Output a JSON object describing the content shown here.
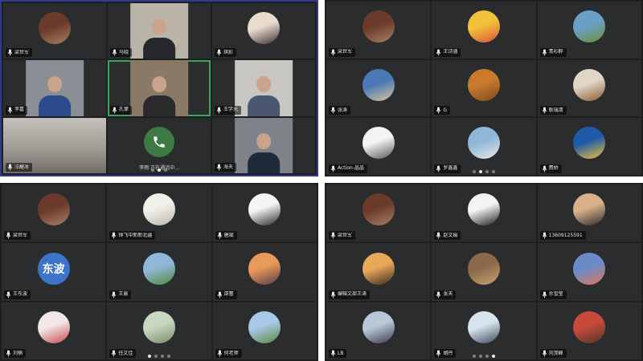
{
  "colors": {
    "panel_background": "#1e1f21",
    "tile_background": "#2b2c2e",
    "active_border": "#2f3a8f",
    "speaking_border": "#3aa55c",
    "phone_green": "#3d7a46",
    "dot_inactive": "#7d7e80",
    "dot_active": "#e6e6e6"
  },
  "panels": [
    {
      "tiles": [
        {
          "name": "梁世军",
          "kind": "avatar",
          "avatar": {
            "colors": [
              "#6b3a2a",
              "#a88064"
            ]
          }
        },
        {
          "name": "马晓",
          "kind": "video",
          "video": {
            "bg": "#b9b3a8",
            "shirt": "#26282e"
          }
        },
        {
          "name": "琪彩",
          "kind": "avatar",
          "avatar": {
            "colors": [
              "#e8dccf",
              "#3a3030"
            ]
          }
        },
        {
          "name": "李嘉",
          "kind": "video",
          "video": {
            "bg": "#8a8f95",
            "shirt": "#2b4b8c"
          }
        },
        {
          "name": "孔擎",
          "kind": "video",
          "speaking": true,
          "video": {
            "bg": "#8a7a65",
            "shirt": "#2a2a2c"
          }
        },
        {
          "name": "王学光",
          "kind": "video",
          "video": {
            "bg": "#c8c6c0",
            "shirt": "#4b5670"
          }
        },
        {
          "name": "汪醒冰",
          "kind": "video-full",
          "video": {
            "bg": "#9b9891",
            "shirt": "#c3c1ba"
          }
        },
        {
          "name": "李雨",
          "kind": "phone",
          "caption": "李雨 正在通话中..."
        },
        {
          "name": "海天",
          "kind": "video",
          "video": {
            "bg": "#7f8389",
            "shirt": "#1f2a3a"
          }
        }
      ],
      "pages": 3,
      "active_page": 1
    },
    {
      "tiles": [
        {
          "name": "梁世军",
          "kind": "avatar",
          "avatar": {
            "colors": [
              "#6b3a2a",
              "#a88064"
            ]
          }
        },
        {
          "name": "王诗涵",
          "kind": "avatar",
          "avatar": {
            "colors": [
              "#f2c23a",
              "#d9533a"
            ]
          }
        },
        {
          "name": "青衫醉",
          "kind": "avatar",
          "avatar": {
            "colors": [
              "#6aa0c8",
              "#6b8f3a"
            ]
          }
        },
        {
          "name": "张涛",
          "kind": "avatar",
          "avatar": {
            "colors": [
              "#4a77b5",
              "#d8c6a0"
            ]
          }
        },
        {
          "name": "G",
          "kind": "avatar",
          "avatar": {
            "colors": [
              "#c97a2e",
              "#7a4a1e"
            ]
          }
        },
        {
          "name": "耿瑞清",
          "kind": "avatar",
          "avatar": {
            "colors": [
              "#e0d6c8",
              "#8a5a30"
            ]
          }
        },
        {
          "name": "Action-晶晶",
          "kind": "avatar",
          "avatar": {
            "colors": [
              "#f4f4f4",
              "#555555"
            ]
          }
        },
        {
          "name": "罗鑫鑫",
          "kind": "avatar",
          "avatar": {
            "colors": [
              "#8fb7d8",
              "#e8e8e8"
            ]
          }
        },
        {
          "name": "费娇",
          "kind": "avatar",
          "avatar": {
            "colors": [
              "#1e5aa8",
              "#f3c13a"
            ]
          }
        }
      ],
      "pages": 4,
      "active_page": 1
    },
    {
      "tiles": [
        {
          "name": "梁世军",
          "kind": "avatar",
          "avatar": {
            "colors": [
              "#6b3a2a",
              "#a88064"
            ]
          }
        },
        {
          "name": "钟飞中新新北疆",
          "kind": "avatar",
          "avatar": {
            "colors": [
              "#f0efe8",
              "#bdb6a8"
            ]
          }
        },
        {
          "name": "唐斌",
          "kind": "avatar",
          "avatar": {
            "colors": [
              "#f4f4f4",
              "#2a2a2a"
            ]
          }
        },
        {
          "name": "王东波",
          "kind": "text-avatar",
          "avatar": {
            "text": "东波",
            "colors": [
              "#3b74c8",
              "#3b74c8"
            ]
          }
        },
        {
          "name": "王晨",
          "kind": "avatar",
          "avatar": {
            "colors": [
              "#8fb8d8",
              "#4f8a3a"
            ]
          }
        },
        {
          "name": "邵蕾",
          "kind": "avatar",
          "avatar": {
            "colors": [
              "#e89a5a",
              "#5a3a4a"
            ]
          }
        },
        {
          "name": "刘楠",
          "kind": "avatar",
          "avatar": {
            "colors": [
              "#f2e6e6",
              "#c84a4a"
            ]
          }
        },
        {
          "name": "任文佳",
          "kind": "avatar",
          "avatar": {
            "colors": [
              "#c8d8c0",
              "#7a8a6a"
            ]
          }
        },
        {
          "name": "何老师",
          "kind": "avatar",
          "avatar": {
            "colors": [
              "#a8c8e8",
              "#5a8a3a"
            ]
          }
        }
      ],
      "pages": 4,
      "active_page": 0
    },
    {
      "tiles": [
        {
          "name": "梁世军",
          "kind": "avatar",
          "avatar": {
            "colors": [
              "#6b3a2a",
              "#a88064"
            ]
          }
        },
        {
          "name": "赵文娟",
          "kind": "avatar",
          "avatar": {
            "colors": [
              "#f4f4f4",
              "#1e1e1e"
            ]
          }
        },
        {
          "name": "13609125591",
          "kind": "avatar",
          "avatar": {
            "colors": [
              "#d8b08a",
              "#2a2a30"
            ]
          }
        },
        {
          "name": "编辑文部王涛",
          "kind": "avatar",
          "avatar": {
            "colors": [
              "#e8a85a",
              "#3a2a1e"
            ]
          }
        },
        {
          "name": "张天",
          "kind": "avatar",
          "avatar": {
            "colors": [
              "#8a6a4a",
              "#c8a070"
            ]
          }
        },
        {
          "name": "佘雪莹",
          "kind": "avatar",
          "avatar": {
            "colors": [
              "#6a8ac8",
              "#d87a5a"
            ]
          }
        },
        {
          "name": "LB",
          "kind": "avatar",
          "avatar": {
            "colors": [
              "#b8c8d8",
              "#3a3a48"
            ]
          }
        },
        {
          "name": "胡丹",
          "kind": "avatar",
          "avatar": {
            "colors": [
              "#d8e4ec",
              "#3a4a5a"
            ]
          }
        },
        {
          "name": "刘顶峰",
          "kind": "avatar",
          "avatar": {
            "colors": [
              "#c84a3a",
              "#4a3a2a"
            ]
          }
        }
      ],
      "pages": 4,
      "active_page": 3
    }
  ]
}
